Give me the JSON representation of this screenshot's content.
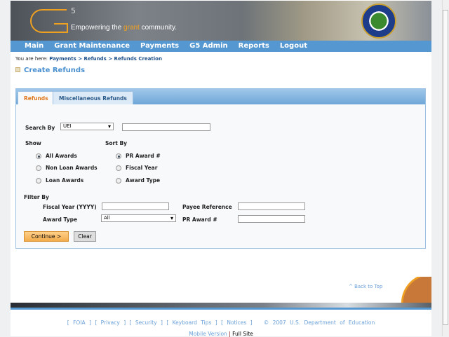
{
  "banner": {
    "logo": "G5",
    "tagline_pre": "Empowering the ",
    "tagline_accent": "grant",
    "tagline_post": " community."
  },
  "nav": [
    "Main",
    "Grant Maintenance",
    "Payments",
    "G5 Admin",
    "Reports",
    "Logout"
  ],
  "breadcrumb": {
    "prefix": "You are here:",
    "path": "Payments > Refunds > Refunds Creation"
  },
  "page_title": "Create Refunds",
  "tabs": [
    "Refunds",
    "Miscellaneous Refunds"
  ],
  "form": {
    "search_by_label": "Search By",
    "search_by_value": "UEI",
    "search_text": "",
    "show_label": "Show",
    "show_options": [
      "All Awards",
      "Non Loan Awards",
      "Loan Awards"
    ],
    "sort_label": "Sort By",
    "sort_options": [
      "PR Award #",
      "Fiscal Year",
      "Award Type"
    ],
    "filter_label": "Filter By",
    "fiscal_year_label": "Fiscal Year (YYYY)",
    "payee_label": "Payee Reference",
    "award_type_label": "Award Type",
    "award_type_value": "All",
    "pr_award_label": "PR Award #",
    "continue": "Continue >",
    "clear": "Clear"
  },
  "back_to_top": "^ Back to Top",
  "footer": {
    "links": "[ FOIA ] [ Privacy ] [ Security ] [ Keyboard Tips ] [ Notices ]",
    "copyright": "© 2007 U.S. Department of Education",
    "mobile": "Mobile Version",
    "sep": "|",
    "full": "Full Site"
  }
}
